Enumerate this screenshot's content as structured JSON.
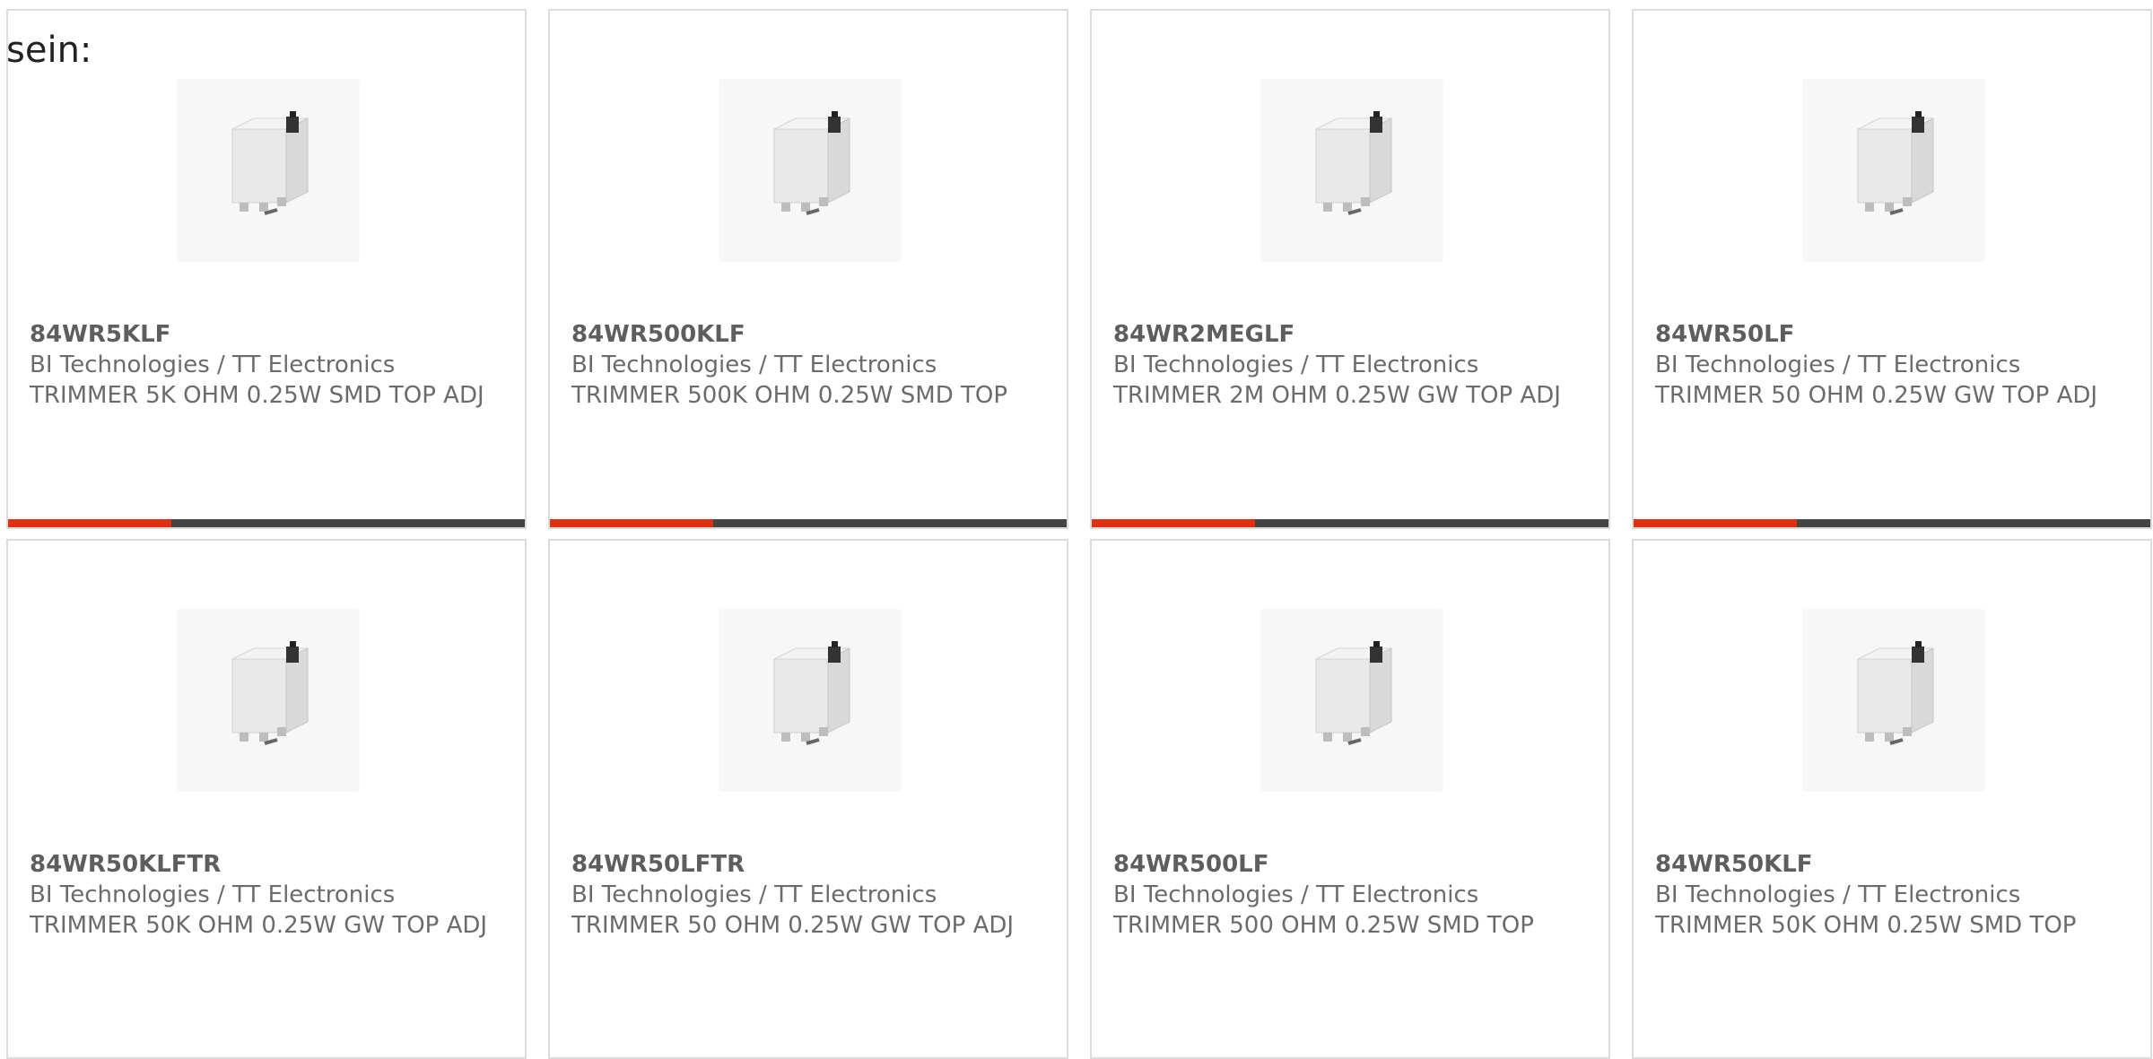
{
  "heading": "sein:",
  "colors": {
    "accent": "#e0300f",
    "bar": "#444444",
    "border": "#dcdcdc",
    "text": "#6b6b6b"
  },
  "cards": [
    {
      "part": "84WR5KLF",
      "manufacturer": "BI Technologies / TT Electronics",
      "description": "TRIMMER 5K OHM 0.25W SMD TOP ADJ",
      "image_icon": "trimmer-potentiometer-icon"
    },
    {
      "part": "84WR500KLF",
      "manufacturer": "BI Technologies / TT Electronics",
      "description": "TRIMMER 500K OHM 0.25W SMD TOP",
      "image_icon": "trimmer-potentiometer-icon"
    },
    {
      "part": "84WR2MEGLF",
      "manufacturer": "BI Technologies / TT Electronics",
      "description": "TRIMMER 2M OHM 0.25W GW TOP ADJ",
      "image_icon": "trimmer-potentiometer-icon"
    },
    {
      "part": "84WR50LF",
      "manufacturer": "BI Technologies / TT Electronics",
      "description": "TRIMMER 50 OHM 0.25W GW TOP ADJ",
      "image_icon": "trimmer-potentiometer-icon"
    },
    {
      "part": "84WR50KLFTR",
      "manufacturer": "BI Technologies / TT Electronics",
      "description": "TRIMMER 50K OHM 0.25W GW TOP ADJ",
      "image_icon": "trimmer-potentiometer-icon"
    },
    {
      "part": "84WR50LFTR",
      "manufacturer": "BI Technologies / TT Electronics",
      "description": "TRIMMER 50 OHM 0.25W GW TOP ADJ",
      "image_icon": "trimmer-potentiometer-icon"
    },
    {
      "part": "84WR500LF",
      "manufacturer": "BI Technologies / TT Electronics",
      "description": "TRIMMER 500 OHM 0.25W SMD TOP",
      "image_icon": "trimmer-potentiometer-icon"
    },
    {
      "part": "84WR50KLF",
      "manufacturer": "BI Technologies / TT Electronics",
      "description": "TRIMMER 50K OHM 0.25W SMD TOP",
      "image_icon": "trimmer-potentiometer-icon"
    }
  ]
}
